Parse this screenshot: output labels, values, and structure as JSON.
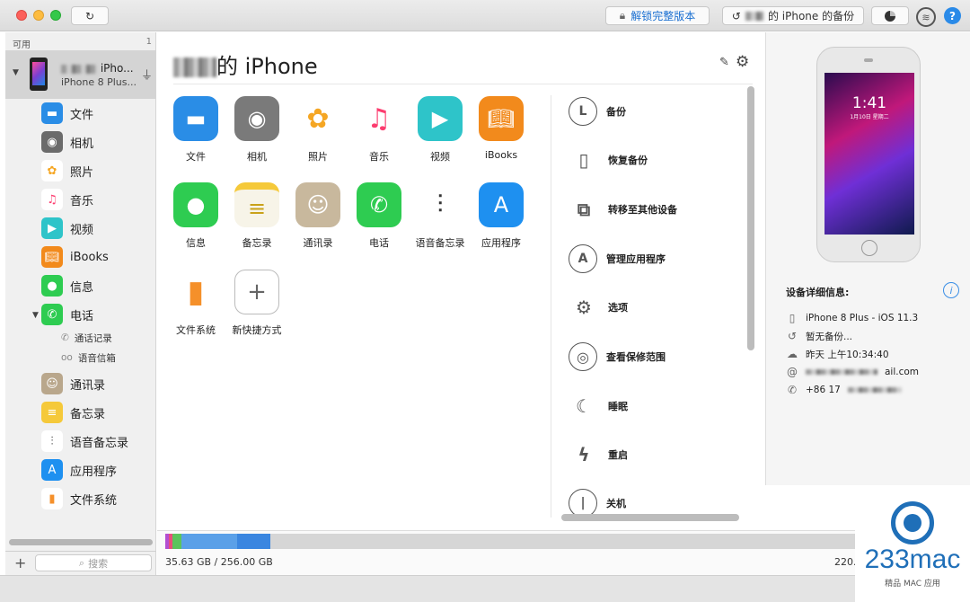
{
  "titlebar": {
    "unlock_label": "解锁完整版本",
    "backup_label": "的 iPhone 的备份",
    "help_label": "?"
  },
  "sidebar": {
    "header": "可用",
    "count": "1",
    "device": {
      "name": "iPho...",
      "model": "iPhone 8 Plus..."
    },
    "items": [
      {
        "label": "文件",
        "icon": "folder-icon",
        "color": "#2a8de6"
      },
      {
        "label": "相机",
        "icon": "camera-icon",
        "color": "#6b6b6b"
      },
      {
        "label": "照片",
        "icon": "photos-icon",
        "color": "#f5a623"
      },
      {
        "label": "音乐",
        "icon": "music-icon",
        "color": "#fc3c6f"
      },
      {
        "label": "视频",
        "icon": "video-icon",
        "color": "#2ec4c9"
      },
      {
        "label": "iBooks",
        "icon": "ibooks-icon",
        "color": "#f28a1c"
      },
      {
        "label": "信息",
        "icon": "messages-icon",
        "color": "#2ecc51"
      },
      {
        "label": "电话",
        "icon": "phone-icon",
        "color": "#2ecc51"
      },
      {
        "label": "通讯录",
        "icon": "contacts-icon",
        "color": "#b9a78c"
      },
      {
        "label": "备忘录",
        "icon": "notes-icon",
        "color": "#f5c93a"
      },
      {
        "label": "语音备忘录",
        "icon": "voice-memo-icon",
        "color": "#444444"
      },
      {
        "label": "应用程序",
        "icon": "appstore-icon",
        "color": "#1e90f0"
      },
      {
        "label": "文件系统",
        "icon": "filesystem-icon",
        "color": "#f5902a"
      }
    ],
    "sub_items": [
      {
        "label": "通话记录",
        "icon": "call-log-icon"
      },
      {
        "label": "语音信箱",
        "icon": "voicemail-icon"
      }
    ],
    "search_placeholder": "搜索"
  },
  "main": {
    "device_title": "的 iPhone",
    "apps": [
      {
        "label": "文件",
        "icon": "folder-icon",
        "color": "#2a8de6"
      },
      {
        "label": "相机",
        "icon": "camera-icon",
        "color": "#7a7a7a"
      },
      {
        "label": "照片",
        "icon": "photos-icon",
        "color": "#ffffff"
      },
      {
        "label": "音乐",
        "icon": "music-icon",
        "color": "#ffffff"
      },
      {
        "label": "视频",
        "icon": "video-icon",
        "color": "#2ec4c9"
      },
      {
        "label": "iBooks",
        "icon": "ibooks-icon",
        "color": "#f28a1c"
      },
      {
        "label": "信息",
        "icon": "messages-icon",
        "color": "#2ecc51"
      },
      {
        "label": "备忘录",
        "icon": "notes-icon",
        "color": "#f7f4e8"
      },
      {
        "label": "通讯录",
        "icon": "contacts-icon",
        "color": "#c8b89d"
      },
      {
        "label": "电话",
        "icon": "phone-icon",
        "color": "#2ecc51"
      },
      {
        "label": "语音备忘录",
        "icon": "voice-memo-icon",
        "color": "#ffffff"
      },
      {
        "label": "应用程序",
        "icon": "appstore-icon",
        "color": "#1e90f0"
      },
      {
        "label": "文件系统",
        "icon": "filesystem-icon",
        "color": "#ffffff"
      },
      {
        "label": "新快捷方式",
        "icon": "add-shortcut-icon",
        "color": "#ffffff"
      }
    ],
    "actions": [
      {
        "label": "备份",
        "icon": "backup-clock-icon"
      },
      {
        "label": "恢复备份",
        "icon": "restore-backup-icon"
      },
      {
        "label": "转移至其他设备",
        "icon": "transfer-device-icon"
      },
      {
        "label": "管理应用程序",
        "icon": "manage-apps-icon"
      },
      {
        "label": "选项",
        "icon": "options-gear-icon"
      },
      {
        "label": "查看保修范围",
        "icon": "warranty-lifebuoy-icon"
      },
      {
        "label": "睡眠",
        "icon": "sleep-moon-icon"
      },
      {
        "label": "重启",
        "icon": "restart-bolt-icon"
      },
      {
        "label": "关机",
        "icon": "power-icon"
      }
    ]
  },
  "storage": {
    "used_text": "35.63 GB / 256.00 GB",
    "right_text": "220.",
    "used_fraction": 0.1392
  },
  "details": {
    "title": "设备详细信息:",
    "lock_time": "1:41",
    "lock_date": "1月10日 星期二",
    "rows": [
      {
        "icon": "phone-outline-icon",
        "text": "iPhone 8 Plus - iOS 11.3"
      },
      {
        "icon": "history-icon",
        "text": "暂无备份..."
      },
      {
        "icon": "cloud-upload-icon",
        "text": "昨天 上午10:34:40"
      },
      {
        "icon": "at-icon",
        "text": "ail.com"
      },
      {
        "icon": "call-icon",
        "text": "+86 17"
      }
    ]
  },
  "watermark": {
    "brand": "233mac",
    "tagline": "精品 MAC 应用"
  }
}
